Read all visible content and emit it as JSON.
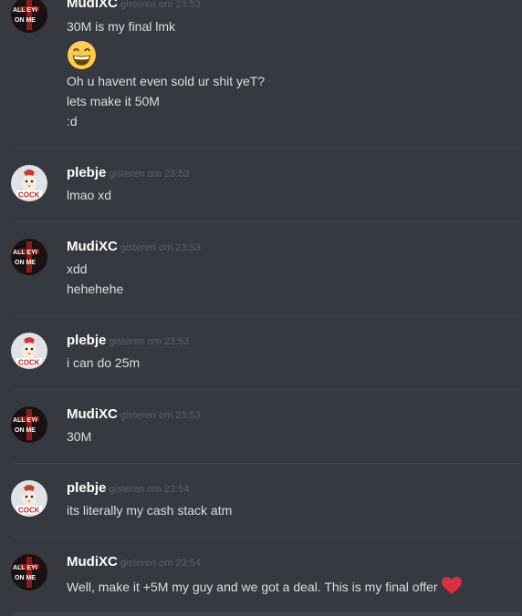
{
  "colors": {
    "background": "#36393f",
    "username": "#ffffff",
    "timestamp": "#5d6067",
    "text": "#dcddde",
    "divider": "#40434a",
    "heart": "#dd2e44",
    "emoji": "#ffcc4d"
  },
  "users": {
    "mudi": {
      "name": "MudiXC",
      "avatar_text_top": "ALL EYI",
      "avatar_text_bottom": "ON ME"
    },
    "plebje": {
      "name": "plebje",
      "avatar_text": "COCK"
    }
  },
  "messages": [
    {
      "author": "MudiXC",
      "time": "gisteren om 23:53",
      "lines": [
        "30M is my final lmk",
        "Oh u havent even sold ur shit yeT?",
        "lets make it 50M",
        ":d"
      ],
      "emoji": "grinning-face-emoji"
    },
    {
      "author": "plebje",
      "time": "gisteren om 23:53",
      "lines": [
        "lmao xd"
      ]
    },
    {
      "author": "MudiXC",
      "time": "gisteren om 23:53",
      "lines": [
        "xdd",
        "hehehehe"
      ]
    },
    {
      "author": "plebje",
      "time": "gisteren om 23:53",
      "lines": [
        "i can do 25m"
      ]
    },
    {
      "author": "MudiXC",
      "time": "gisteren om 23:53",
      "lines": [
        "30M"
      ]
    },
    {
      "author": "plebje",
      "time": "gisteren om 23:54",
      "lines": [
        "its literally my cash stack atm"
      ]
    },
    {
      "author": "MudiXC",
      "time": "gisteren om 23:54",
      "lines": [
        "Well, make it +5M my guy and we got a deal. This is my final offer"
      ],
      "trailing_emoji": "red-heart-emoji"
    }
  ]
}
